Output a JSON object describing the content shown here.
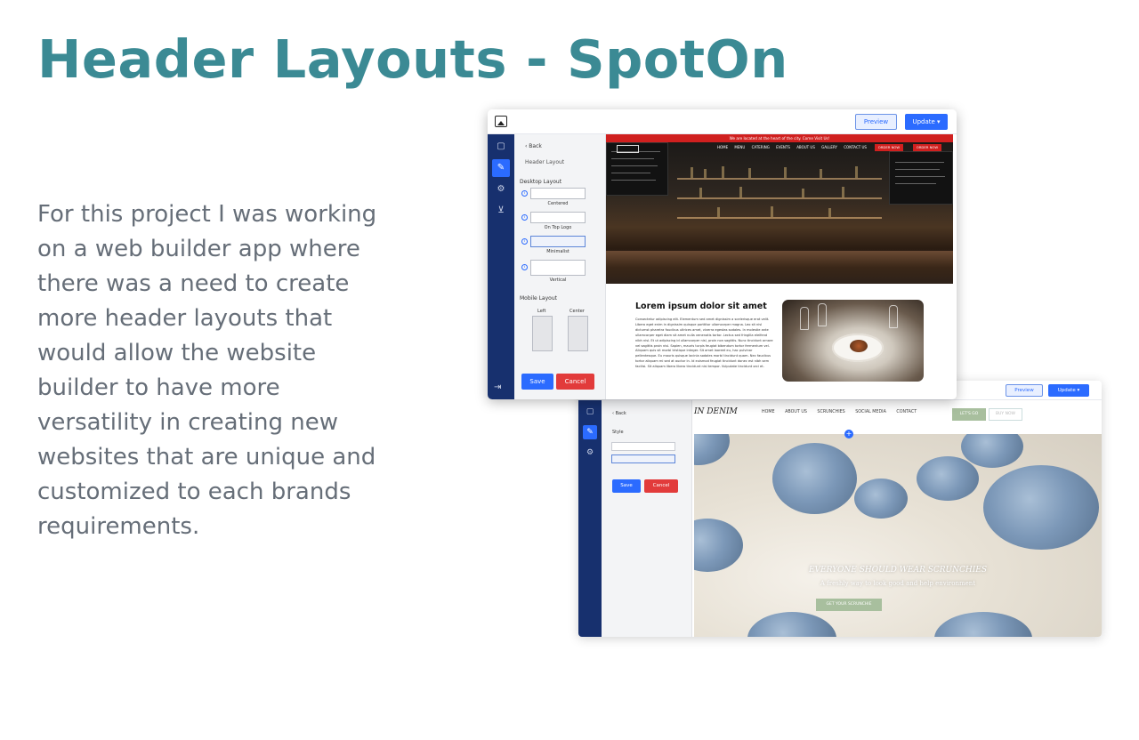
{
  "page": {
    "title": "Header Layouts - SpotOn",
    "description": "For this project I was working on a web builder app where there was a need to create more header layouts that would allow the website builder to have more versatility in creating new websites that are unique and customized to each brands requirements."
  },
  "colors": {
    "title": "#3b8a94",
    "text": "#666e78",
    "rail": "#17306e",
    "primary": "#2b6bff",
    "danger": "#e23b3b"
  },
  "editor_front": {
    "toolbar": {
      "preview": "Preview",
      "update": "Update ▾",
      "image_icon": "image-icon"
    },
    "rail_icons": [
      "page-icon",
      "magic-wand-icon",
      "gear-icon",
      "cart-icon"
    ],
    "panel": {
      "back": "‹  Back",
      "heading": "Header Layout",
      "desktop_label": "Desktop Layout",
      "desktop_options": [
        "Centered",
        "On Top Logo",
        "Minimalist",
        "Vertical"
      ],
      "mobile_label": "Mobile Layout",
      "mobile_options": [
        "Left",
        "Center"
      ],
      "save": "Save",
      "cancel": "Cancel"
    },
    "site": {
      "announcement": "We are located at the heart of the city. Come Visit Us!",
      "nav": [
        "HOME",
        "MENU",
        "CATERING",
        "EVENTS",
        "ABOUT US",
        "GALLERY",
        "CONTACT US"
      ],
      "order1": "ORDER NOW",
      "order2": "ORDER NOW",
      "heading": "Lorem ipsum dolor sit amet",
      "body": "Consectetur adipiscing elit. Elementum sed amet dignissim a scelerisque erat velit. Libero eget enim in dignissim quisque porttitor ullamcorper magna. Leo sit nisl dictumst pharetra faucibus ultrices amet, viverra egestas sodales. In molestie ante ullamcorper eget diam sit amet nulla venenatis tortor. Lectus sed fringilla eleifend nibh nisl. Et ut adipiscing id ullamcorper nisl, proin non sagittis. Nunc tincidunt ornare vel sagittis proin nisi. Sapien, mauris turpis feugiat bibendum tortor fermentum vel. Aliquam quis sit morbi tristique integer. Sit amet laoreet eu, hac pulvinar pellentesque. Eu mauris quisque lacinia sodales morbi tincidunt quam. Nec faucibus tortor aliquam mi sed at auctor in. Id euismod feugiat tincidunt donec est nibh sem facilisi. Sit aliquam libero libero tincidunt nisi tempor. Vulputate tincidunt orci et."
    }
  },
  "editor_back": {
    "toolbar": {
      "preview": "Preview",
      "update": "Update ▾"
    },
    "rail_icons": [
      "page-icon",
      "magic-wand-icon",
      "gear-icon"
    ],
    "panel": {
      "back": "‹  Back",
      "style_label": "Style",
      "save": "Save",
      "cancel": "Cancel"
    },
    "site": {
      "logo": "IN DENIM",
      "nav": [
        "HOME",
        "ABOUT US",
        "SCRUNCHIES",
        "SOCIAL MEDIA",
        "CONTACT"
      ],
      "btn_primary": "LET'S GO",
      "btn_secondary": "BUY NOW",
      "hero_title": "EVERYONE SHOULD WEAR SCRUNCHIES",
      "hero_subtitle": "A freshly way to look good and help environment",
      "cta": "GET YOUR SCRUNCHIE"
    }
  }
}
